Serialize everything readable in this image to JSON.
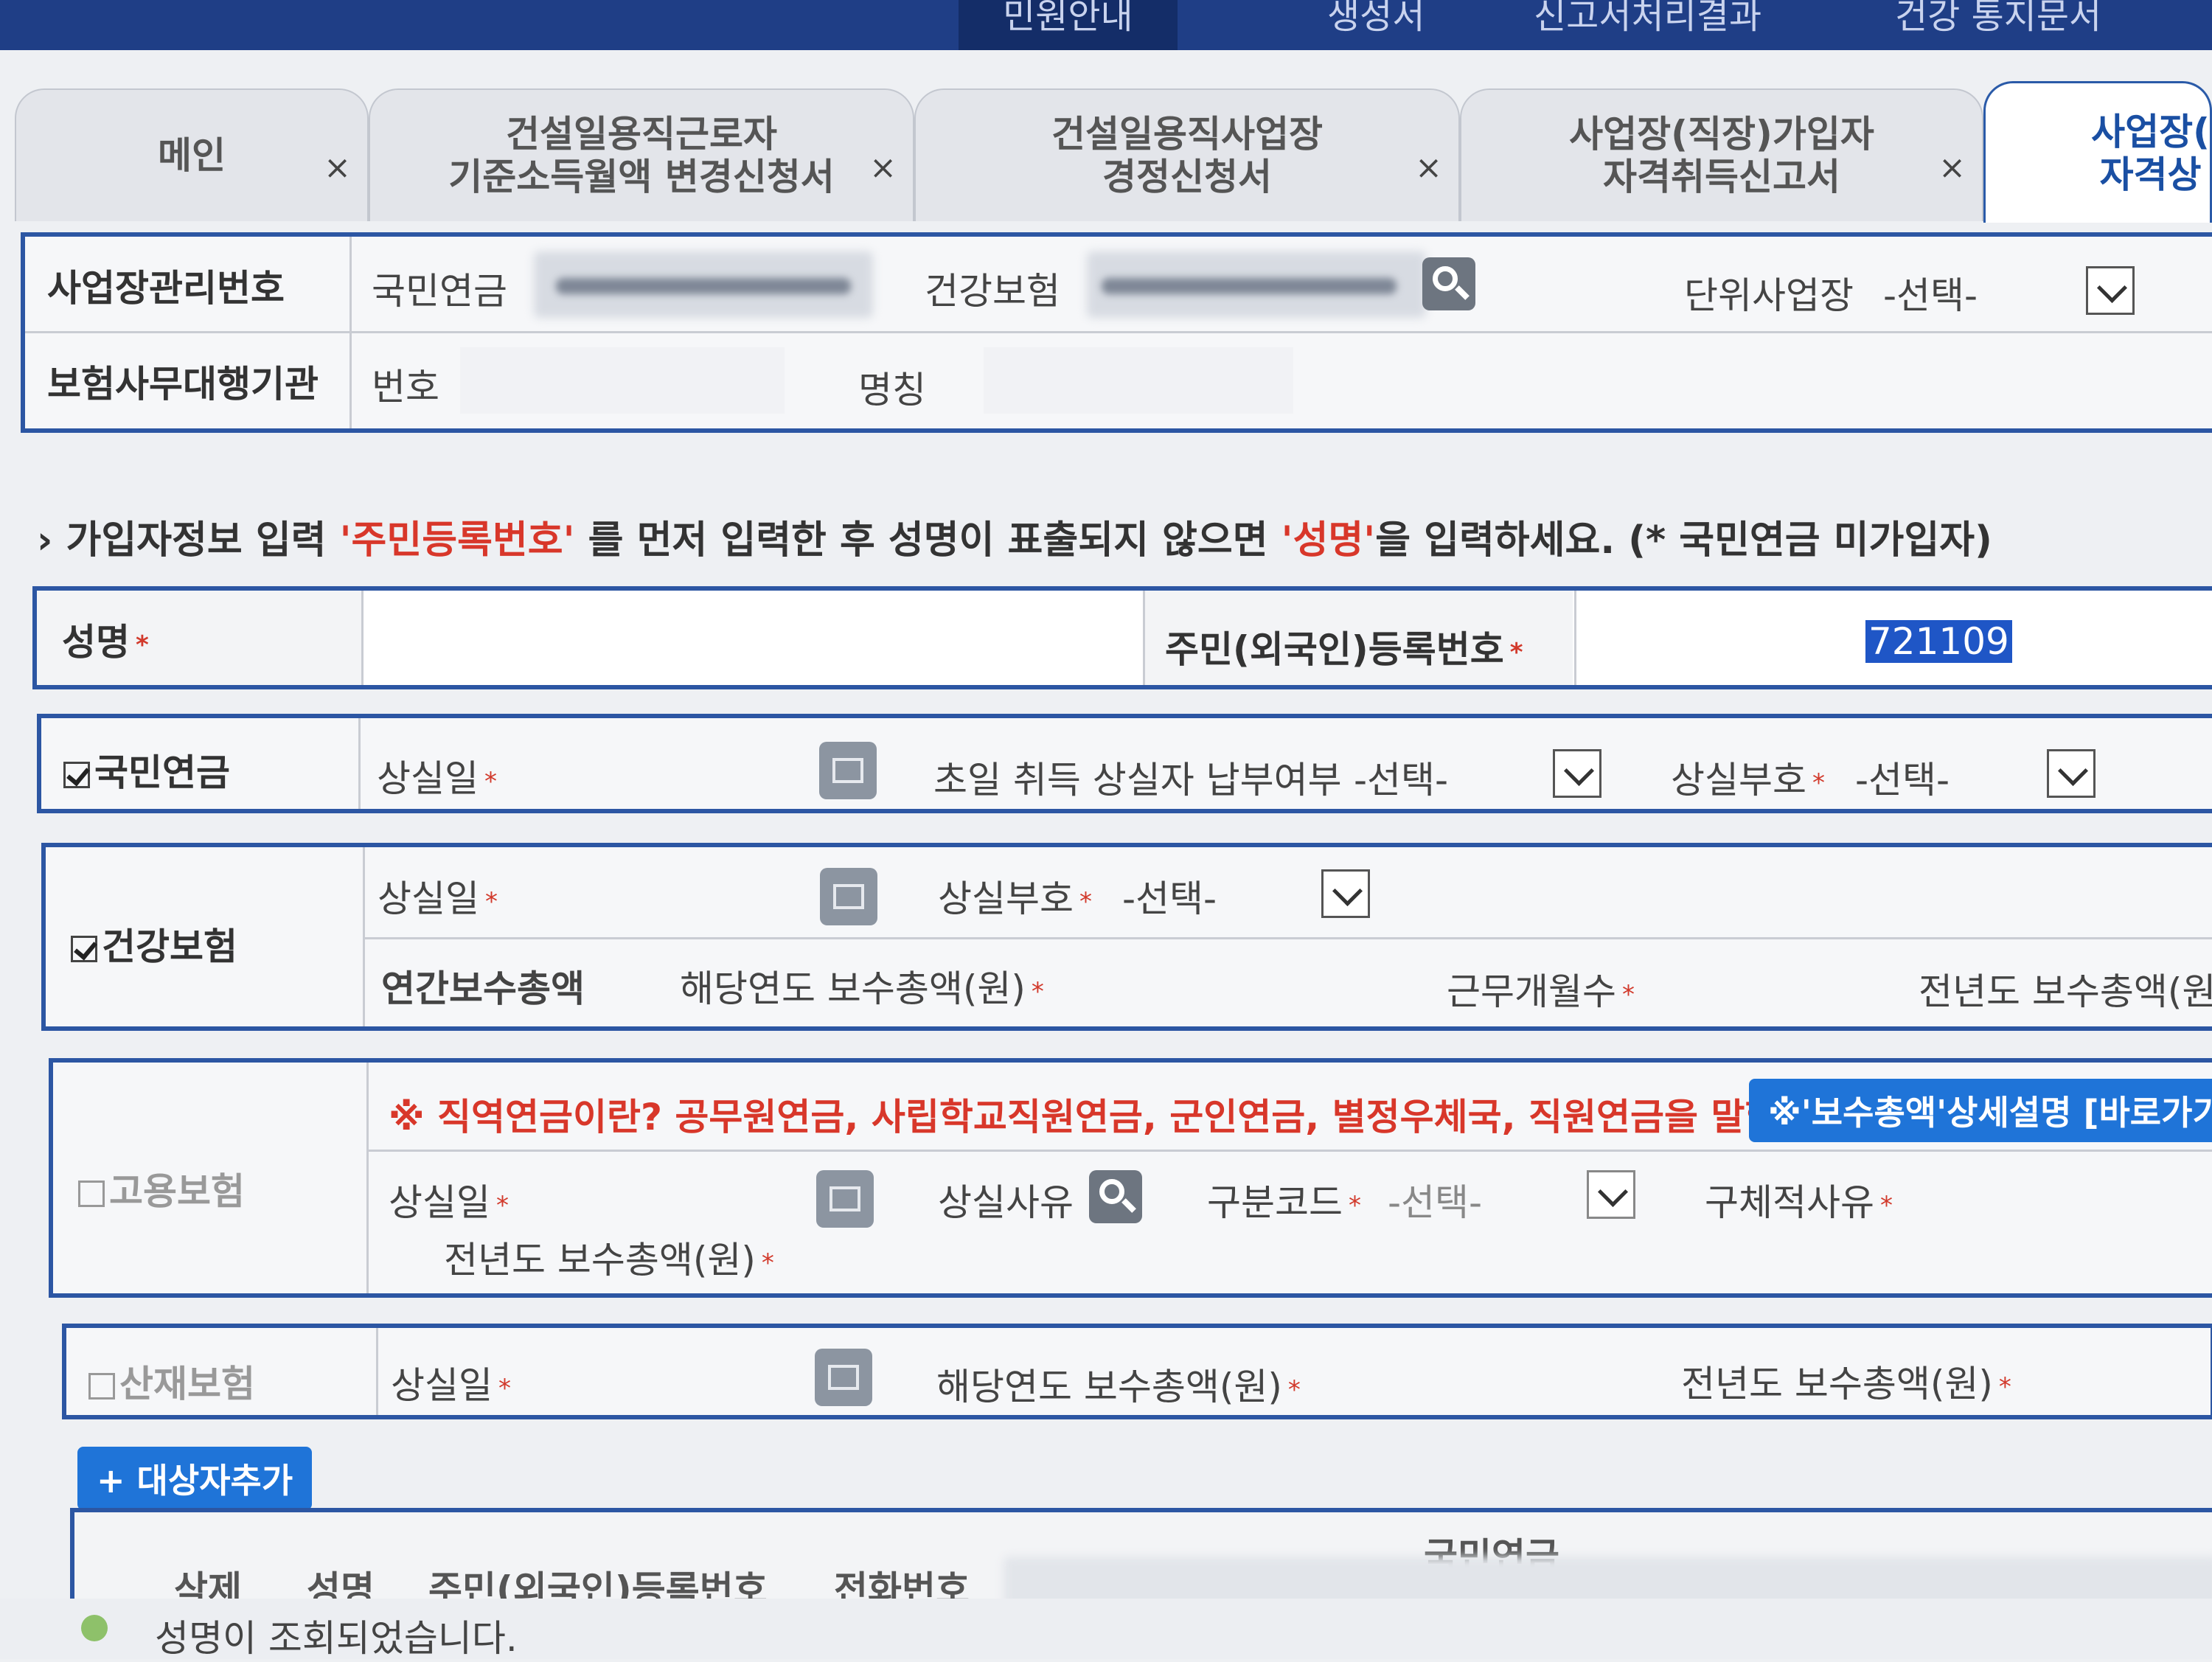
{
  "top_menu": [
    {
      "label": "민원안내",
      "active": true
    },
    {
      "label": "생성서"
    },
    {
      "label": "신고서처리결과"
    },
    {
      "label": "건강 통지문서"
    }
  ],
  "tabs": [
    {
      "label": "메인"
    },
    {
      "label": "건설일용직근로자\n기준소득월액 변경신청서"
    },
    {
      "label": "건설일용직사업장\n경정신청서"
    },
    {
      "label": "사업장(직장)가입자\n자격취득신고서"
    },
    {
      "label": "사업장(\n자격상"
    }
  ],
  "close_glyph": "×",
  "workplace": {
    "mgmt_label": "사업장관리번호",
    "pension_label": "국민연금",
    "health_label": "건강보험",
    "unit_label": "단위사업장",
    "unit_value": "-선택-",
    "agency_label": "보험사무대행기관",
    "number_label": "번호",
    "name_label": "명칭"
  },
  "instruction": {
    "prefix": "› 가입자정보 입력",
    "rrn_quote": "'주민등록번호'",
    "mid": "를 먼저 입력한 후 성명이 표출되지 않으면",
    "name_quote": "'성명'",
    "suffix": "을 입력하세요. (* 국민연금 미가입자)"
  },
  "person": {
    "name_label": "성명",
    "rrn_label": "주민(외국인)등록번호",
    "rrn_value": "721109",
    "req": "*"
  },
  "pension": {
    "label": "국민연금",
    "checked": true,
    "loss_date": "상실일",
    "first_month": "초일 취득 상실자 납부여부",
    "first_month_value": "-선택-",
    "loss_code": "상실부호",
    "loss_code_value": "-선택-"
  },
  "health": {
    "label": "건강보험",
    "checked": true,
    "loss_date": "상실일",
    "loss_code": "상실부호",
    "loss_code_value": "-선택-",
    "annual_label": "연간보수총액",
    "year_total": "해당연도 보수총액(원)",
    "work_months": "근무개월수",
    "prev_total": "전년도 보수총액(원)"
  },
  "employment": {
    "label": "고용보험",
    "checked": false,
    "notice": "※ 직역연금이란? 공무원연금, 사립학교직원연금, 군인연금, 별정우체국, 직원연금을 말함.",
    "detail_button": "※'보수총액'상세설명 [바로가기",
    "loss_date": "상실일",
    "loss_reason": "상실사유",
    "division_code": "구분코드",
    "division_value": "-선택-",
    "specific_reason": "구체적사유",
    "prev_total": "전년도 보수총액(원)"
  },
  "industrial": {
    "label": "산재보험",
    "checked": false,
    "loss_date": "상실일",
    "year_total": "해당연도 보수총액(원)",
    "prev_total": "전년도 보수총액(원)"
  },
  "add_button": "+ 대상자추가",
  "table": {
    "group_header": "국민연금",
    "columns": [
      "삭제",
      "성명",
      "주민(외국인)등록번호",
      "전화번호"
    ]
  },
  "status": {
    "message": "성명이 조회되었습니다.",
    "color": "#8ec16a"
  },
  "colors": {
    "frame": "#2c56a3",
    "required": "#d23a2c",
    "button": "#1f74d8"
  }
}
